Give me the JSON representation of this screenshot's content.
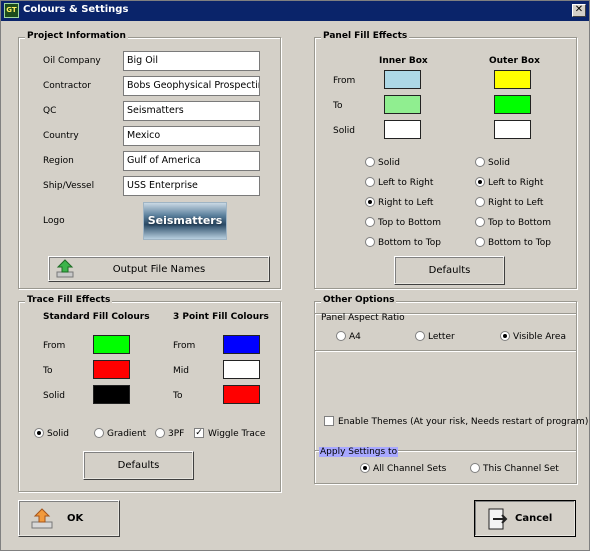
{
  "window": {
    "title": "Colours & Settings",
    "icon_text": "GT",
    "close_symbol": "✕"
  },
  "project": {
    "legend": "Project Information",
    "fields": [
      {
        "label": "Oil Company",
        "value": "Big Oil"
      },
      {
        "label": "Contractor",
        "value": "Bobs Geophysical Prospecting"
      },
      {
        "label": "QC",
        "value": "Seismatters"
      },
      {
        "label": "Country",
        "value": "Mexico"
      },
      {
        "label": "Region",
        "value": "Gulf of America"
      },
      {
        "label": "Ship/Vessel",
        "value": "USS Enterprise"
      }
    ],
    "logo_label": "Logo",
    "logo_text": "Seismatters",
    "output_button": "Output File Names"
  },
  "panel_fill": {
    "legend": "Panel Fill Effects",
    "inner_header": "Inner Box",
    "outer_header": "Outer Box",
    "rows": [
      "From",
      "To",
      "Solid"
    ],
    "inner_colors": [
      "#add8e6",
      "#90ee90",
      "#ffffff"
    ],
    "outer_colors": [
      "#ffff00",
      "#00ff00",
      "#ffffff"
    ],
    "options": [
      "Solid",
      "Left to Right",
      "Right to Left",
      "Top to Bottom",
      "Bottom to Top"
    ],
    "inner_selected": "Right to Left",
    "outer_selected": "Left to Right",
    "defaults_button": "Defaults"
  },
  "trace_fill": {
    "legend": "Trace Fill Effects",
    "standard_header": "Standard Fill Colours",
    "three_point_header": "3 Point Fill Colours",
    "standard_rows": [
      "From",
      "To",
      "Solid"
    ],
    "standard_colors": [
      "#00ff00",
      "#ff0000",
      "#000000"
    ],
    "three_point_rows": [
      "From",
      "Mid",
      "To"
    ],
    "three_point_colors": [
      "#0000ff",
      "#ffffff",
      "#ff0000"
    ],
    "mode_options": [
      "Solid",
      "Gradient",
      "3PF"
    ],
    "mode_selected": "Solid",
    "wiggle_label": "Wiggle Trace",
    "wiggle_checked": true,
    "defaults_button": "Defaults"
  },
  "other": {
    "legend": "Other Options",
    "aspect_label": "Panel Aspect Ratio",
    "aspect_options": [
      "A4",
      "Letter",
      "Visible Area"
    ],
    "aspect_selected": "Visible Area",
    "themes_label": "Enable Themes (At your risk, Needs restart of program)",
    "themes_checked": false,
    "apply_label": "Apply Settings to",
    "apply_options": [
      "All Channel Sets",
      "This Channel Set"
    ],
    "apply_selected": "All Channel Sets"
  },
  "footer": {
    "ok": "OK",
    "cancel": "Cancel"
  }
}
